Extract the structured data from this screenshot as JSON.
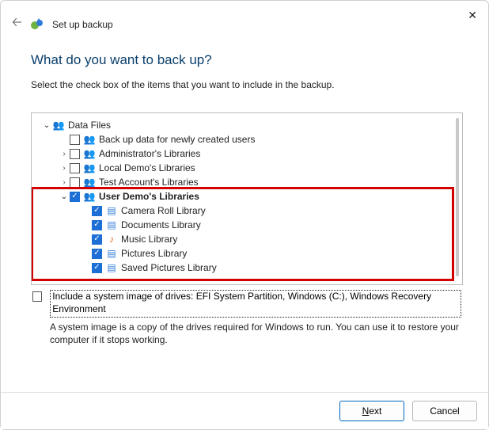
{
  "window": {
    "title": "Set up backup"
  },
  "heading": "What do you want to back up?",
  "instructions": "Select the check box of the items that you want to include in the backup.",
  "tree": {
    "root": {
      "label": "Data Files",
      "children": [
        {
          "label": "Back up data for newly created users",
          "checked": false
        },
        {
          "label": "Administrator's Libraries",
          "checked": false,
          "expandable": true
        },
        {
          "label": "Local Demo's Libraries",
          "checked": false,
          "expandable": true
        },
        {
          "label": "Test Account's Libraries",
          "checked": false,
          "expandable": true
        },
        {
          "label": "User Demo's Libraries",
          "checked": true,
          "expanded": true,
          "bold": true,
          "children": [
            {
              "label": "Camera Roll Library",
              "checked": true
            },
            {
              "label": "Documents Library",
              "checked": true
            },
            {
              "label": "Music Library",
              "checked": true,
              "iconVariant": "music"
            },
            {
              "label": "Pictures Library",
              "checked": true
            },
            {
              "label": "Saved Pictures Library",
              "checked": true
            }
          ]
        }
      ]
    }
  },
  "systemImage": {
    "checked": false,
    "label": "Include a system image of drives: EFI System Partition, Windows (C:), Windows Recovery Environment",
    "description": "A system image is a copy of the drives required for Windows to run. You can use it to restore your computer if it stops working."
  },
  "buttons": {
    "next": "Next",
    "cancel": "Cancel"
  }
}
